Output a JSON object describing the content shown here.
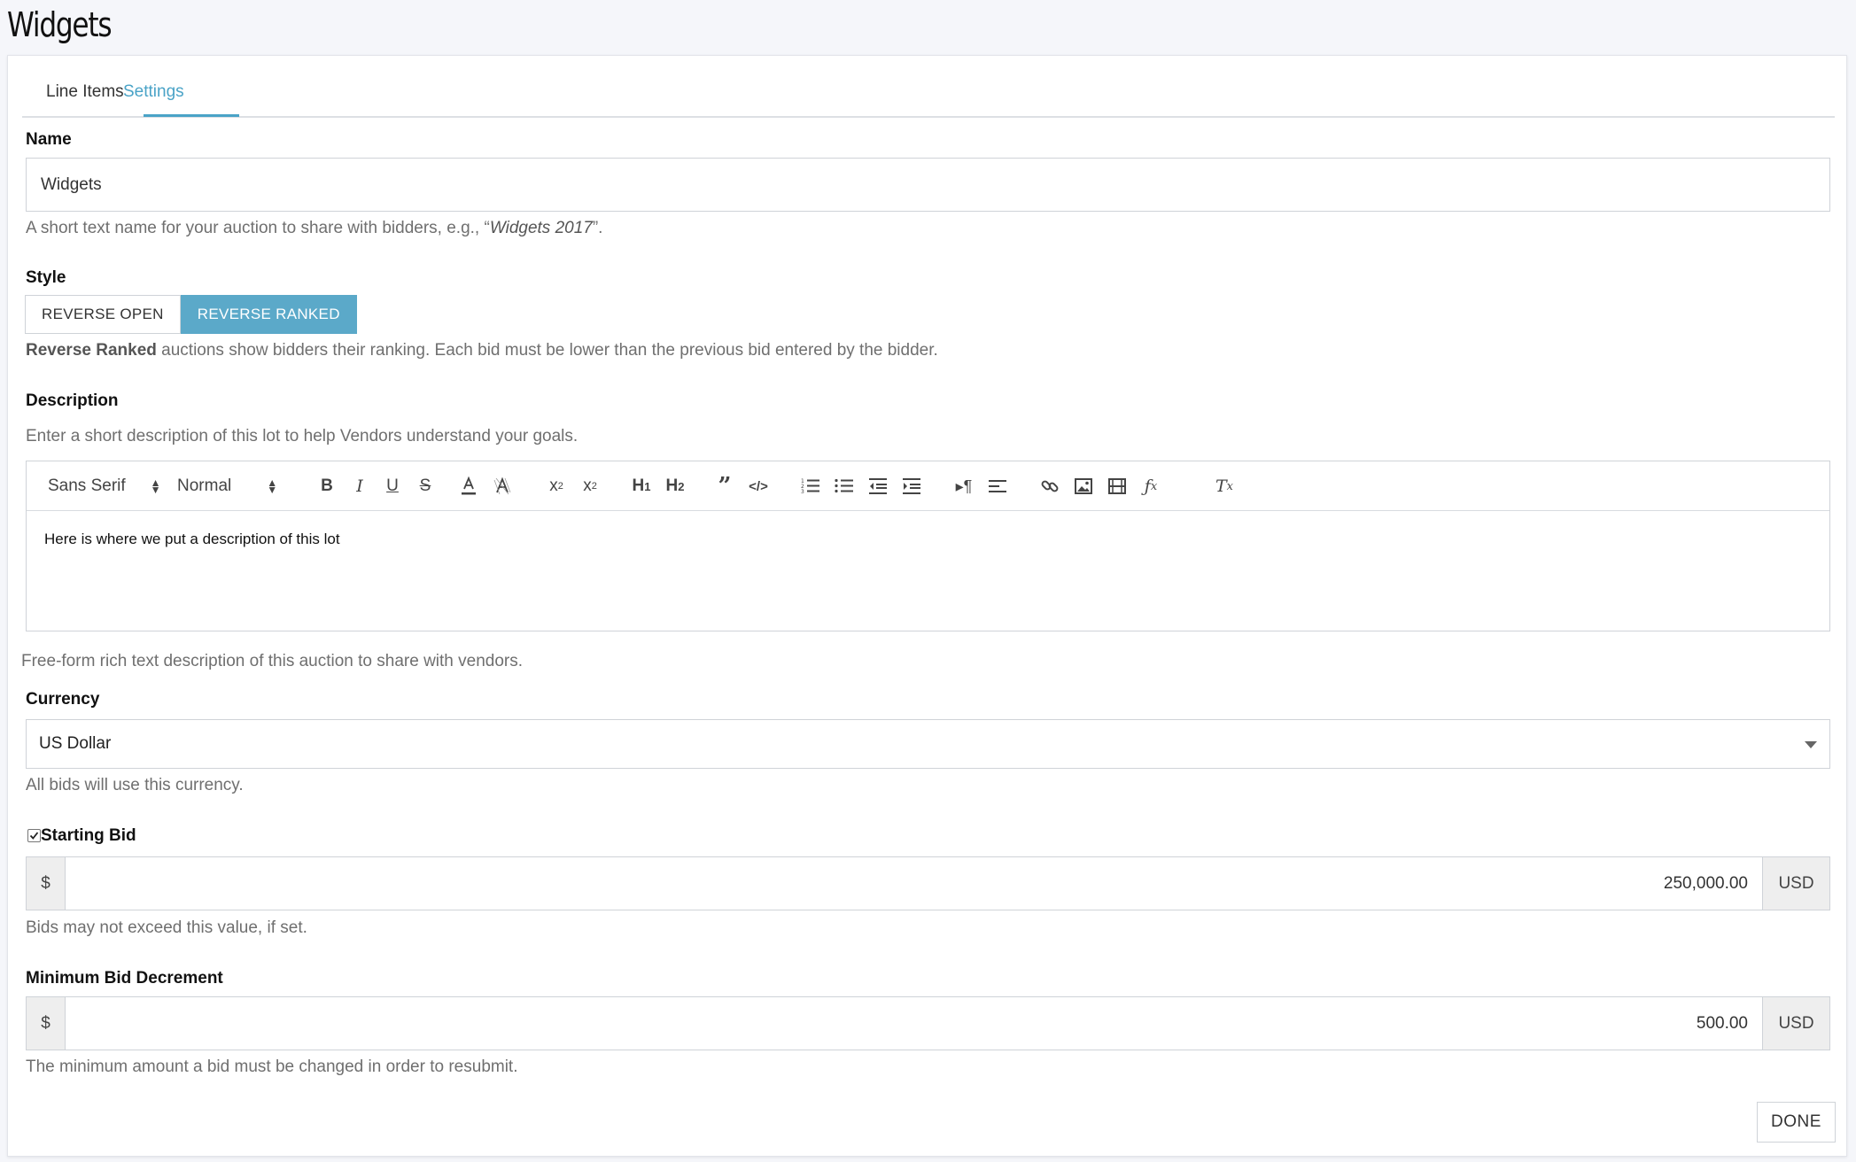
{
  "page": {
    "title": "Widgets"
  },
  "tabs": [
    {
      "label": "Line Items",
      "active": false
    },
    {
      "label": "Settings",
      "active": true
    }
  ],
  "name": {
    "label": "Name",
    "value": "Widgets",
    "help_prefix": "A short text name for your auction to share with bidders, e.g., “",
    "help_example": "Widgets 2017",
    "help_suffix": "”."
  },
  "style": {
    "label": "Style",
    "options": [
      {
        "label": "REVERSE OPEN",
        "selected": false
      },
      {
        "label": "REVERSE RANKED",
        "selected": true
      }
    ],
    "help_bold": "Reverse Ranked",
    "help_rest": " auctions show bidders their ranking. Each bid must be lower than the previous bid entered by the bidder."
  },
  "description": {
    "label": "Description",
    "help_top": "Enter a short description of this lot to help Vendors understand your goals.",
    "toolbar": {
      "font": "Sans Serif",
      "size": "Normal",
      "icons": [
        "bold-icon",
        "italic-icon",
        "underline-icon",
        "strike-icon",
        "font-color-icon",
        "background-color-icon",
        "subscript-icon",
        "superscript-icon",
        "heading1-icon",
        "heading2-icon",
        "blockquote-icon",
        "code-block-icon",
        "ordered-list-icon",
        "bullet-list-icon",
        "outdent-icon",
        "indent-icon",
        "text-direction-icon",
        "align-icon",
        "link-icon",
        "image-icon",
        "video-icon",
        "formula-icon",
        "clear-format-icon"
      ]
    },
    "content": "Here is where we put a description of this lot",
    "help_bottom": "Free-form rich text description of this auction to share with vendors."
  },
  "currency": {
    "label": "Currency",
    "value": "US Dollar",
    "help": "All bids will use this currency."
  },
  "starting_bid": {
    "label": "Starting Bid",
    "checked": true,
    "prefix": "$",
    "value": "250,000.00",
    "suffix": "USD",
    "help": "Bids may not exceed this value, if set."
  },
  "min_decrement": {
    "label": "Minimum Bid Decrement",
    "prefix": "$",
    "value": "500.00",
    "suffix": "USD",
    "help": "The minimum amount a bid must be changed in order to resubmit."
  },
  "actions": {
    "done_label": "DONE"
  },
  "colors": {
    "accent": "#4aa3c7",
    "active_segment": "#5ba9c9"
  }
}
